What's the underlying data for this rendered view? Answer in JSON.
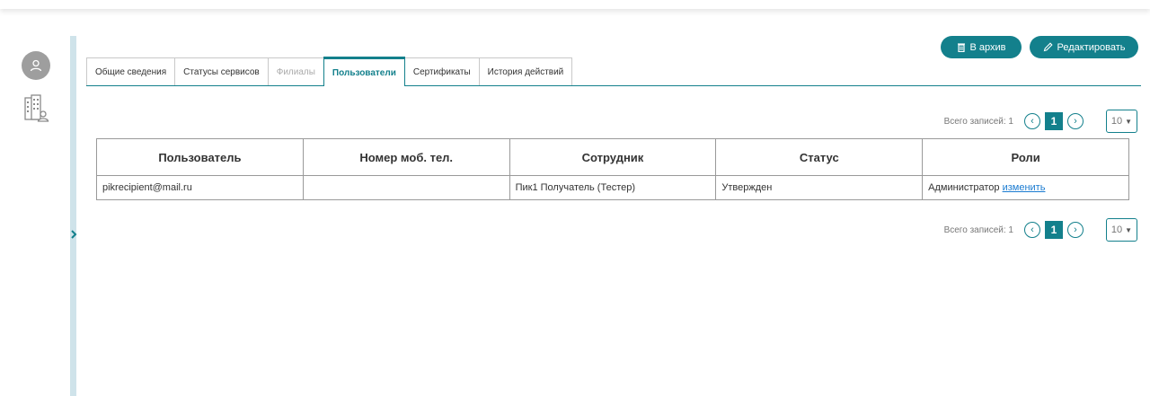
{
  "colors": {
    "accent": "#13808c",
    "divider": "#cfe3ea",
    "link": "#1a7bd1"
  },
  "leftnav": {
    "avatar_icon": "user-avatar-icon",
    "org_icon": "organization-icon",
    "expander_icon": "chevron-right-icon"
  },
  "actions": {
    "archive_label": "В архив",
    "archive_icon": "trash-icon",
    "edit_label": "Редактировать",
    "edit_icon": "pencil-icon"
  },
  "tabs": [
    {
      "label": "Общие сведения",
      "state": "normal"
    },
    {
      "label": "Статусы сервисов",
      "state": "normal"
    },
    {
      "label": "Филиалы",
      "state": "disabled"
    },
    {
      "label": "Пользователи",
      "state": "active"
    },
    {
      "label": "Сертификаты",
      "state": "normal"
    },
    {
      "label": "История действий",
      "state": "normal"
    }
  ],
  "pager": {
    "total_label": "Всего записей: 1",
    "current_page": "1",
    "per_page": "10"
  },
  "table": {
    "headers": [
      "Пользователь",
      "Номер моб. тел.",
      "Сотрудник",
      "Статус",
      "Роли"
    ],
    "rows": [
      {
        "user": "pikrecipient@mail.ru",
        "phone": "",
        "employee": "Пик1 Получатель (Тестер)",
        "status": "Утвержден",
        "role": "Администратор",
        "role_action": "изменить"
      }
    ]
  }
}
